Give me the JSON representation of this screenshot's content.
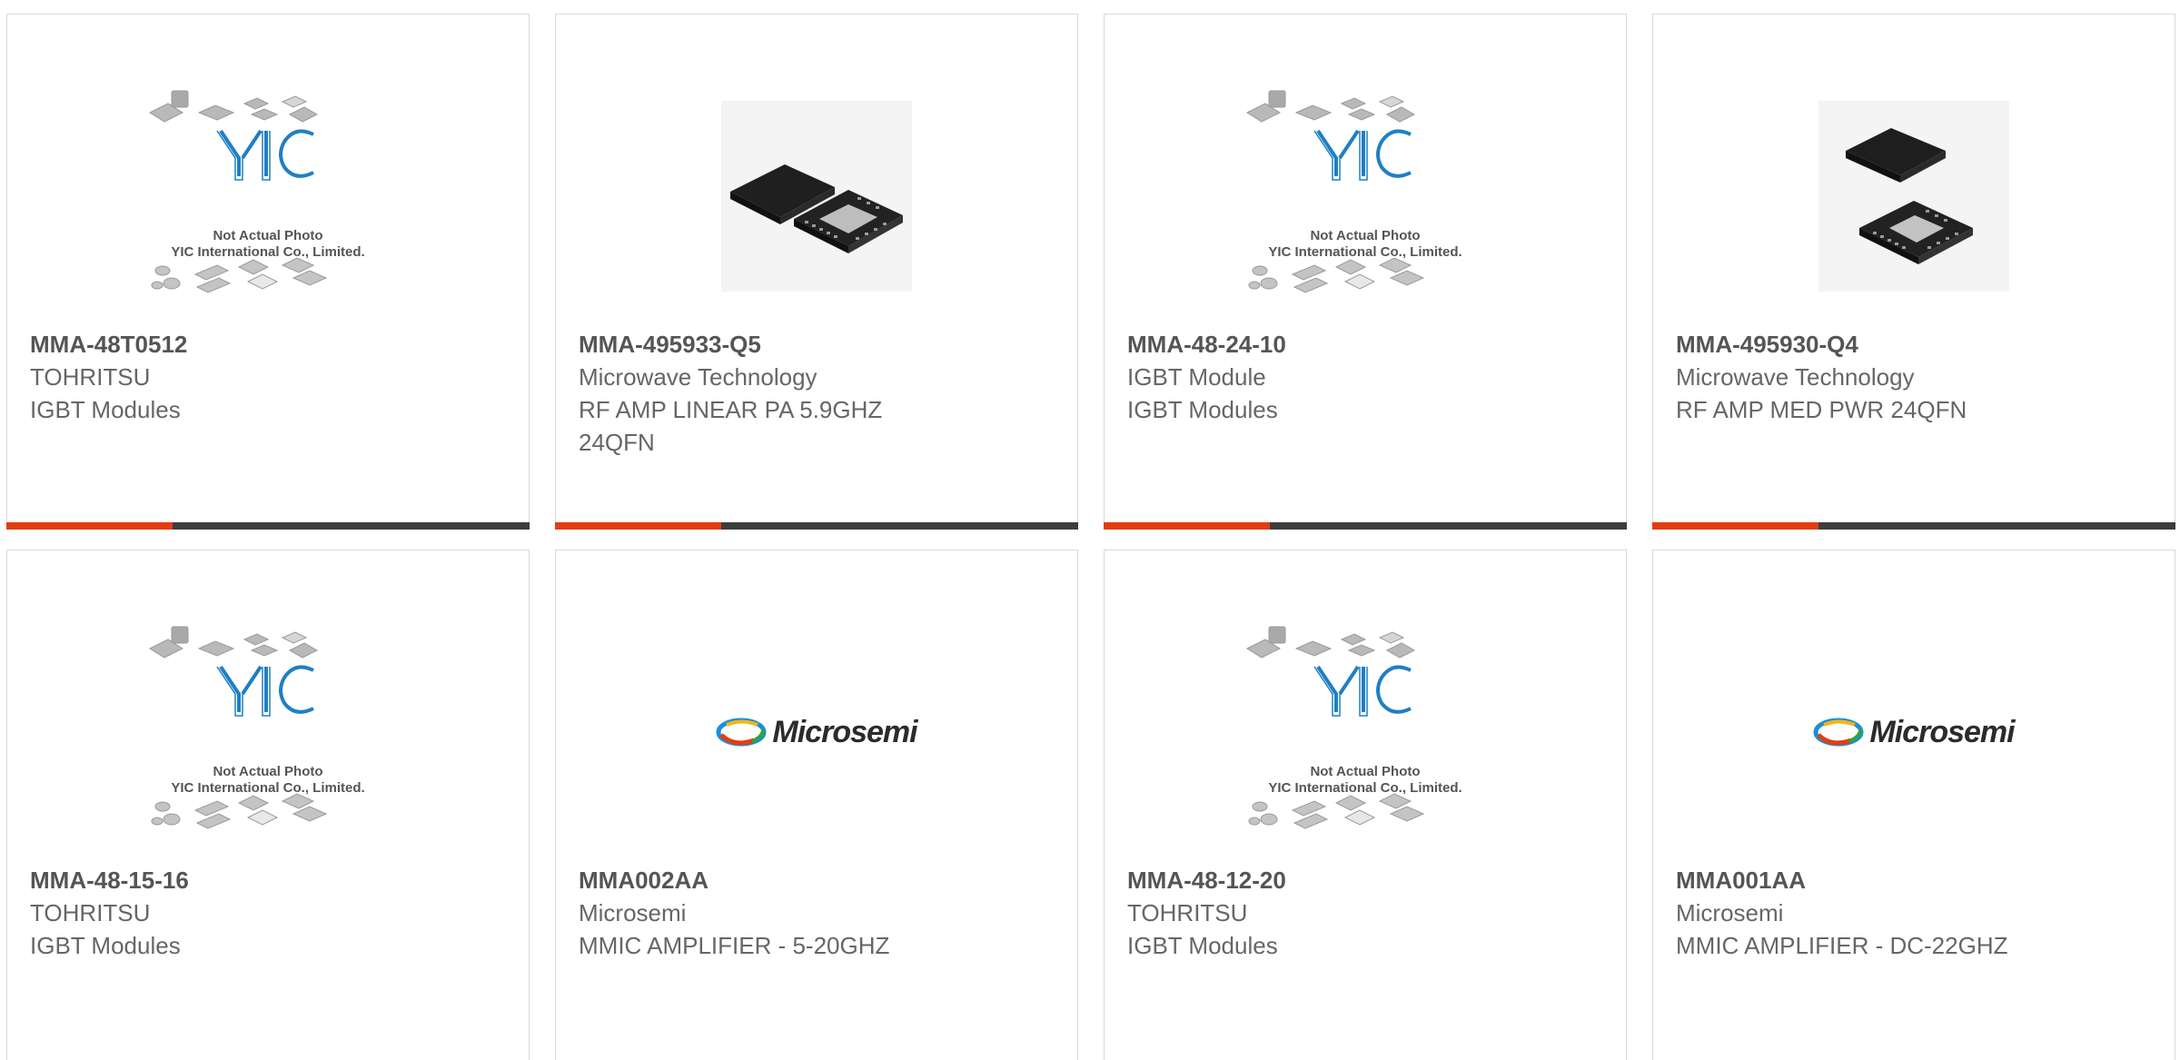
{
  "products": [
    {
      "part_number": "MMA-48T0512",
      "manufacturer": "TOHRITSU",
      "description": "IGBT Modules",
      "image": "yic-placeholder",
      "caption_line1": "Not Actual Photo",
      "caption_line2": "YIC International Co., Limited.",
      "logo_text": "YIC"
    },
    {
      "part_number": "MMA-495933-Q5",
      "manufacturer": "Microwave Technology",
      "description": "RF AMP LINEAR PA 5.9GHZ 24QFN",
      "image": "qfn-chip-photo"
    },
    {
      "part_number": "MMA-48-24-10",
      "manufacturer": "IGBT Module",
      "description": "IGBT Modules",
      "image": "yic-placeholder",
      "caption_line1": "Not Actual Photo",
      "caption_line2": "YIC International Co., Limited.",
      "logo_text": "YIC"
    },
    {
      "part_number": "MMA-495930-Q4",
      "manufacturer": "Microwave Technology",
      "description": "RF AMP MED PWR 24QFN",
      "image": "qfn-chip-photo"
    },
    {
      "part_number": "MMA-48-15-16",
      "manufacturer": "TOHRITSU",
      "description": "IGBT Modules",
      "image": "yic-placeholder",
      "caption_line1": "Not Actual Photo",
      "caption_line2": "YIC International Co., Limited.",
      "logo_text": "YIC"
    },
    {
      "part_number": "MMA002AA",
      "manufacturer": "Microsemi",
      "description": "MMIC AMPLIFIER - 5-20GHZ",
      "image": "microsemi-logo",
      "logo_text": "Microsemi"
    },
    {
      "part_number": "MMA-48-12-20",
      "manufacturer": "TOHRITSU",
      "description": "IGBT Modules",
      "image": "yic-placeholder",
      "caption_line1": "Not Actual Photo",
      "caption_line2": "YIC International Co., Limited.",
      "logo_text": "YIC"
    },
    {
      "part_number": "MMA001AA",
      "manufacturer": "Microsemi",
      "description": "MMIC AMPLIFIER - DC-22GHZ",
      "image": "microsemi-logo",
      "logo_text": "Microsemi"
    }
  ],
  "colors": {
    "accent": "#e23d12",
    "bar": "#3d3d3d",
    "border": "#d9d9d9",
    "yic_blue": "#1e7fc4"
  }
}
